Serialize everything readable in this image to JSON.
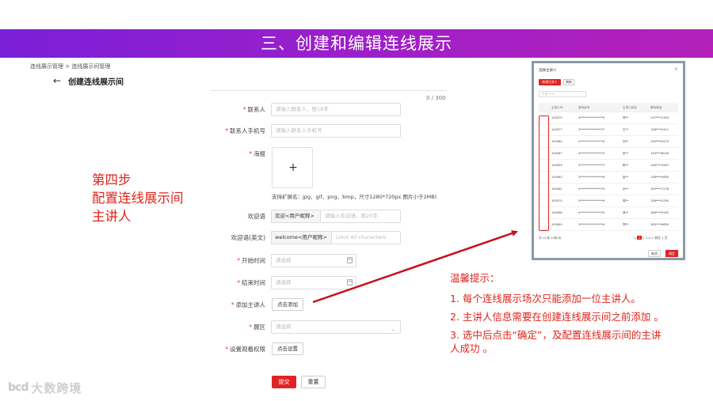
{
  "banner": {
    "title": "三、创建和编辑连线展示"
  },
  "breadcrumb": "连线展示管理 > 连线展示间管理",
  "page": {
    "title": "创建连线展示间",
    "counter": "0 / 300"
  },
  "form": {
    "contact": {
      "label": "联系人",
      "placeholder": "请输入联系人，限18字"
    },
    "contact_phone": {
      "label": "联系人手机号",
      "placeholder": "请输入联系人手机号"
    },
    "poster": {
      "label": "海报",
      "upload_symbol": "+",
      "hint": "支持扩展名：jpg、gif、png、bmp，尺寸1280*720px 图片小于2MB)"
    },
    "welcome": {
      "label": "欢迎语",
      "prefix": "欢迎<用户昵称>",
      "placeholder": "请输入欢迎语，限20字"
    },
    "welcome_en": {
      "label": "欢迎语(英文)",
      "prefix": "welcome<用户昵称>",
      "placeholder": "Limit 40 characters"
    },
    "start_time": {
      "label": "开始时间",
      "placeholder": "请选择"
    },
    "end_time": {
      "label": "结束时间",
      "placeholder": "请选择"
    },
    "speaker": {
      "label": "添加主讲人",
      "button": "点击添加"
    },
    "zone": {
      "label": "展区",
      "placeholder": "请选择"
    },
    "permission": {
      "label": "设置观看权限",
      "button": "点击设置"
    },
    "submit": "提交",
    "reset": "重置"
  },
  "step": {
    "line1": "第四步",
    "line2": "配置连线展示间",
    "line3": "主讲人"
  },
  "popup": {
    "title": "选择主讲人",
    "close": "×",
    "add_button": "新增主讲人",
    "refresh_button": "刷新",
    "search_placeholder": "主讲人ID",
    "columns": [
      "主讲人ID",
      "身份证号",
      "主讲人姓名",
      "联系电话"
    ],
    "rows": [
      [
        "100075",
        "4****************5",
        "李**",
        "137****2303"
      ],
      [
        "100077",
        "3****************7",
        "王**",
        "138****5411"
      ],
      [
        "100082",
        "5****************X",
        "刘**",
        "135****0473"
      ],
      [
        "100087",
        "4****************2",
        "张**",
        "139****8026"
      ],
      [
        "100054",
        "4****************1",
        "陈**",
        "136****4487"
      ],
      [
        "100062",
        "3****************6",
        "赵**",
        "138****4600"
      ],
      [
        "100061",
        "4****************3",
        "孙**",
        "150****1178"
      ],
      [
        "100070",
        "5****************9",
        "周**",
        "158****2295"
      ],
      [
        "100066",
        "4****************0",
        "吴**",
        "186****3302"
      ],
      [
        "100060",
        "3****************4",
        "郑**",
        "189****6650"
      ]
    ],
    "footer_left": "共 14 条  10条/页",
    "pagination": {
      "prev": "<",
      "pages": [
        "1",
        "2",
        "3",
        "4"
      ],
      "next": ">",
      "jump": "前往 1 页"
    },
    "cancel": "取消",
    "confirm": "确定"
  },
  "tips": {
    "title": "温馨提示：",
    "items": [
      "1. 每个连线展示场次只能添加一位主讲人。",
      "2. 主讲人信息需要在创建连线展示间之前添加  。",
      "3. 选中后点击“确定”，及配置连线展示间的主讲人成功  。"
    ]
  },
  "logo": {
    "mark": "bcd",
    "text": "大数跨境"
  },
  "colors": {
    "banner_start": "#7a1fd8",
    "banner_end": "#b321b9",
    "accent_red": "#e0241b"
  }
}
